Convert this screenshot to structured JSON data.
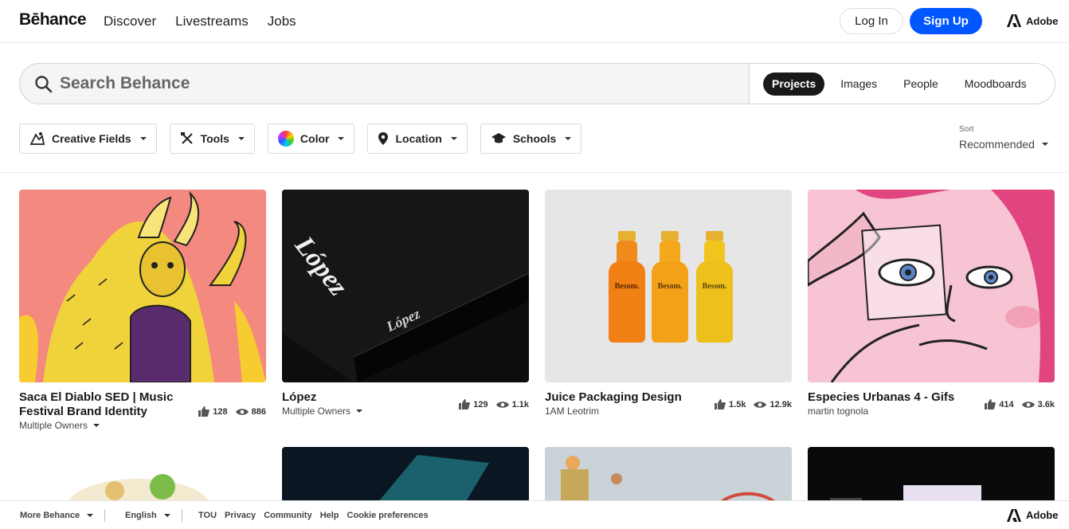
{
  "header": {
    "logo": "Bēhance",
    "nav": [
      "Discover",
      "Livestreams",
      "Jobs"
    ],
    "login_label": "Log In",
    "signup_label": "Sign Up",
    "adobe_label": "Adobe"
  },
  "search": {
    "placeholder": "Search Behance",
    "scopes": [
      "Projects",
      "Images",
      "People",
      "Moodboards"
    ],
    "active_scope": "Projects"
  },
  "filters": {
    "items": [
      "Creative Fields",
      "Tools",
      "Color",
      "Location",
      "Schools"
    ],
    "sort_label": "Sort",
    "sort_value": "Recommended"
  },
  "projects": [
    {
      "title": "Saca El Diablo SED | Music Festival Brand Identity",
      "likes": "128",
      "views": "886",
      "owner": "Multiple Owners",
      "owner_dropdown": true
    },
    {
      "title": "López",
      "likes": "129",
      "views": "1.1k",
      "owner": "Multiple Owners",
      "owner_dropdown": true,
      "thumb_text_1": "López",
      "thumb_text_2": "López"
    },
    {
      "title": "Juice Packaging Design",
      "likes": "1.5k",
      "views": "12.9k",
      "owner": "1AM Leotrim",
      "owner_dropdown": false,
      "bottle_label": "Besom."
    },
    {
      "title": "Especies Urbanas 4 - Gifs",
      "likes": "414",
      "views": "3.6k",
      "owner": "martin tognola",
      "owner_dropdown": false
    }
  ],
  "footer": {
    "more": "More Behance",
    "language": "English",
    "links": [
      "TOU",
      "Privacy",
      "Community",
      "Help",
      "Cookie preferences"
    ],
    "adobe": "Adobe"
  },
  "colors": {
    "accent": "#0057ff",
    "active_scope_bg": "#191919",
    "card1_bg": "#f4897f",
    "card2_bg": "#0d0d0d",
    "card3_bg": "#e6e6e6",
    "card4_bg": "#f2a0b8"
  }
}
